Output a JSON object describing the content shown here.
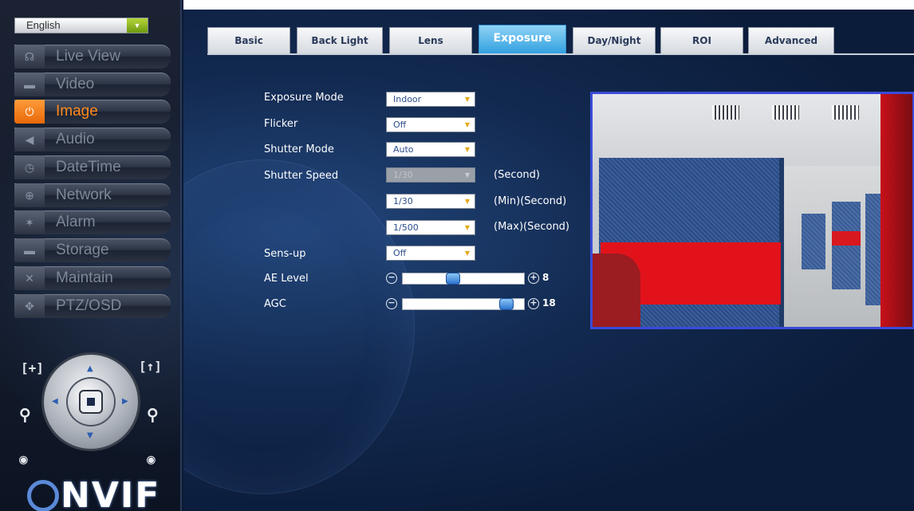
{
  "sidebar": {
    "language": "English",
    "items": [
      {
        "label": "Live View",
        "icon": "speech-icon"
      },
      {
        "label": "Video",
        "icon": "camera-icon"
      },
      {
        "label": "Image",
        "icon": "power-icon",
        "active": true
      },
      {
        "label": "Audio",
        "icon": "speaker-icon"
      },
      {
        "label": "DateTime",
        "icon": "clock-icon"
      },
      {
        "label": "Network",
        "icon": "network-icon"
      },
      {
        "label": "Alarm",
        "icon": "alarm-icon"
      },
      {
        "label": "Storage",
        "icon": "storage-icon"
      },
      {
        "label": "Maintain",
        "icon": "tools-icon"
      },
      {
        "label": "PTZ/OSD",
        "icon": "ptz-icon"
      }
    ],
    "logo": "ONVIF"
  },
  "tabs": [
    "Basic",
    "Back Light",
    "Lens",
    "Exposure",
    "Day/Night",
    "ROI",
    "Advanced"
  ],
  "active_tab": "Exposure",
  "form": {
    "exposure_mode": {
      "label": "Exposure Mode",
      "value": "Indoor"
    },
    "flicker": {
      "label": "Flicker",
      "value": "Off"
    },
    "shutter_mode": {
      "label": "Shutter Mode",
      "value": "Auto"
    },
    "shutter_speed": {
      "label": "Shutter Speed",
      "value": "1/30",
      "unit": "(Second)"
    },
    "shutter_min": {
      "value": "1/30",
      "unit": "(Min)(Second)"
    },
    "shutter_max": {
      "value": "1/500",
      "unit": "(Max)(Second)"
    },
    "sens_up": {
      "label": "Sens-up",
      "value": "Off"
    },
    "ae_level": {
      "label": "AE Level",
      "value": "8",
      "fraction": 0.4
    },
    "agc": {
      "label": "AGC",
      "value": "18",
      "fraction": 0.9
    }
  },
  "colors": {
    "accent": "#2f9fdf",
    "active_menu": "#ff8a1c",
    "preview_border": "#3a4bd8"
  }
}
